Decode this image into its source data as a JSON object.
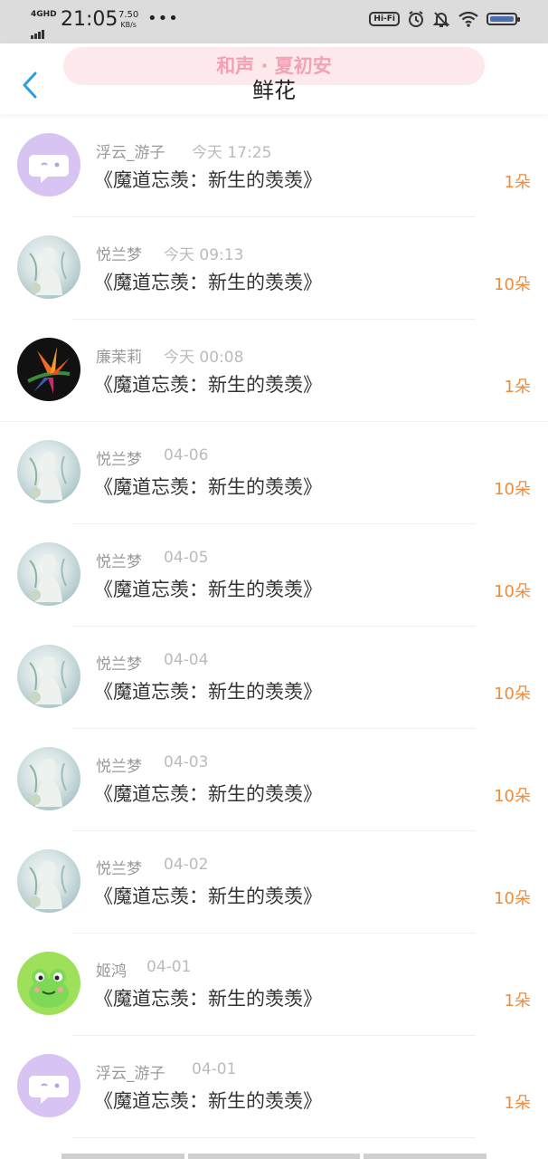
{
  "status_bar": {
    "network": "4GHD",
    "time": "21:05",
    "speed_value": "7.50",
    "speed_unit": "KB/s",
    "more": "•••",
    "hifi": "Hi-Fi",
    "icons": [
      "alarm-icon",
      "mute-bell-icon",
      "wifi-icon",
      "battery-icon"
    ]
  },
  "header": {
    "banner_text": "和声 · 夏初安",
    "title": "鲜花",
    "back_icon": "chevron-left-icon"
  },
  "colors": {
    "accent_blue": "#2f9ae6",
    "count_orange": "#ef8c3c",
    "banner_pink": "#f2a2b5"
  },
  "records": [
    {
      "user": "浮云_游子",
      "time": "今天 17:25",
      "title": "《魔道忘羡：新生的羡羡》",
      "count": "1朵",
      "avatar": "chat-bubble-avatar"
    },
    {
      "user": "悦兰梦",
      "time": "今天 09:13",
      "title": "《魔道忘羡：新生的羡羡》",
      "count": "10朵",
      "avatar": "lady-avatar"
    },
    {
      "user": "廉茉莉",
      "time": "今天 00:08",
      "title": "《魔道忘羡：新生的羡羡》",
      "count": "1朵",
      "avatar": "flower-avatar"
    },
    {
      "user": "悦兰梦",
      "time": "04-06",
      "title": "《魔道忘羡：新生的羡羡》",
      "count": "10朵",
      "avatar": "lady-avatar"
    },
    {
      "user": "悦兰梦",
      "time": "04-05",
      "title": "《魔道忘羡：新生的羡羡》",
      "count": "10朵",
      "avatar": "lady-avatar"
    },
    {
      "user": "悦兰梦",
      "time": "04-04",
      "title": "《魔道忘羡：新生的羡羡》",
      "count": "10朵",
      "avatar": "lady-avatar"
    },
    {
      "user": "悦兰梦",
      "time": "04-03",
      "title": "《魔道忘羡：新生的羡羡》",
      "count": "10朵",
      "avatar": "lady-avatar"
    },
    {
      "user": "悦兰梦",
      "time": "04-02",
      "title": "《魔道忘羡：新生的羡羡》",
      "count": "10朵",
      "avatar": "lady-avatar"
    },
    {
      "user": "姬鸿",
      "time": "04-01",
      "title": "《魔道忘羡：新生的羡羡》",
      "count": "1朵",
      "avatar": "frog-avatar"
    },
    {
      "user": "浮云_游子",
      "time": "04-01",
      "title": "《魔道忘羡：新生的羡羡》",
      "count": "1朵",
      "avatar": "chat-bubble-avatar"
    }
  ]
}
